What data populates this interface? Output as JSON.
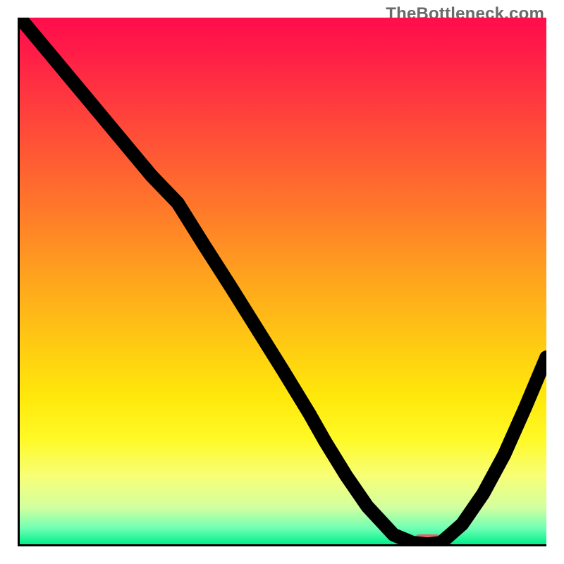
{
  "watermark": "TheBottleneck.com",
  "chart_data": {
    "type": "line",
    "title": "",
    "xlabel": "",
    "ylabel": "",
    "xlim": [
      0,
      100
    ],
    "ylim": [
      0,
      100
    ],
    "grid": false,
    "legend": false,
    "optimum_marker": {
      "x": 77.5,
      "y": 0.9,
      "width": 5.2,
      "height": 1.9
    },
    "series": [
      {
        "name": "bottleneck-curve",
        "x": [
          0,
          5,
          10,
          15,
          20,
          25,
          30,
          35,
          40,
          45,
          50,
          55,
          58,
          62,
          66,
          71,
          74.6,
          77.5,
          80,
          84,
          88,
          92,
          96,
          100
        ],
        "values": [
          100,
          94,
          88,
          82,
          76,
          70,
          64.8,
          56.8,
          49,
          41,
          33,
          24.8,
          19.5,
          13,
          7.2,
          1.8,
          0.3,
          0.0,
          0.3,
          3.8,
          9.6,
          17,
          26,
          35.5
        ]
      }
    ]
  }
}
